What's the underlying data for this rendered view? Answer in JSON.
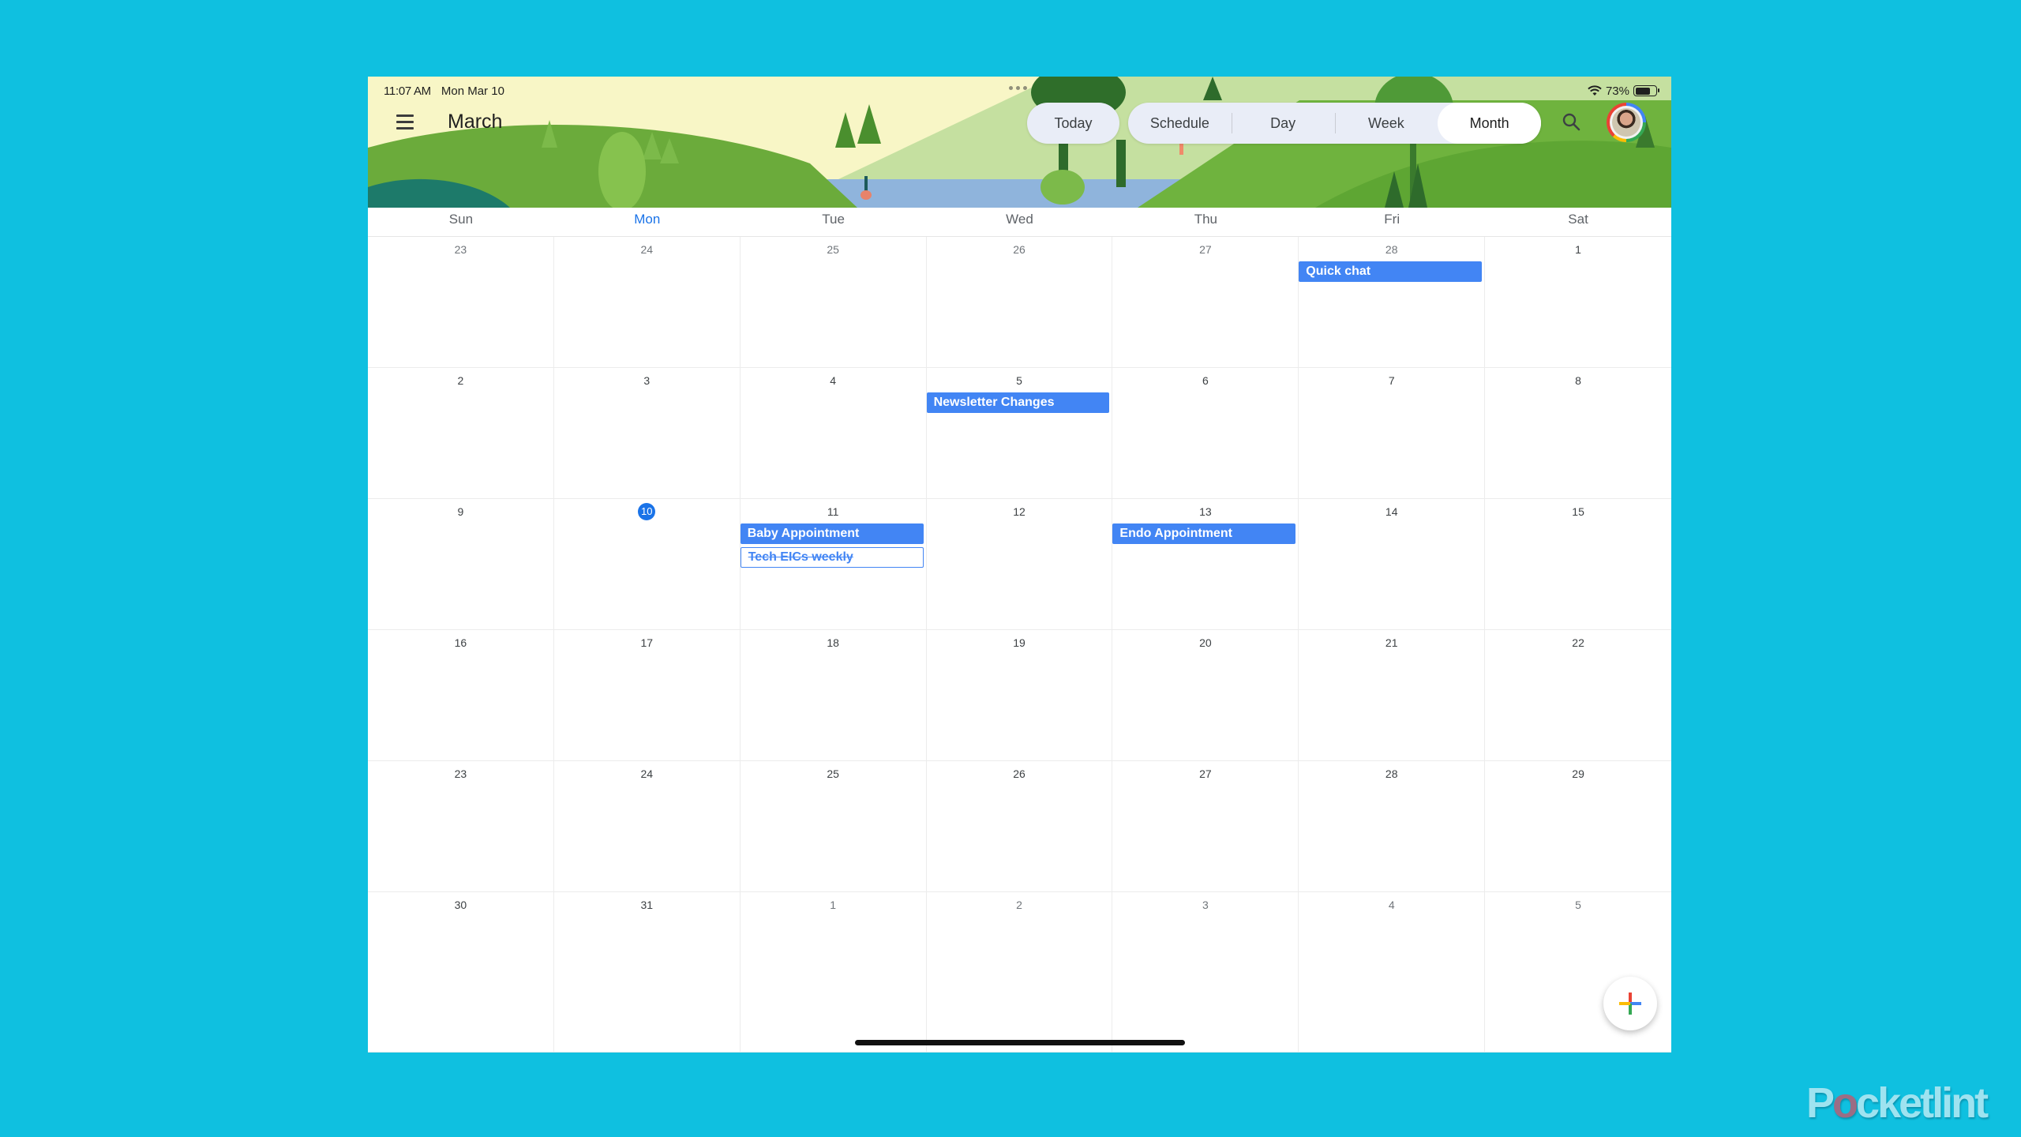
{
  "status_bar": {
    "time": "11:07 AM",
    "date": "Mon Mar 10",
    "battery": "73%",
    "battery_level": 0.73
  },
  "header": {
    "menu_icon": "hamburger-menu-icon",
    "title": "March",
    "today_label": "Today",
    "views": [
      {
        "label": "Schedule",
        "active": false
      },
      {
        "label": "Day",
        "active": false
      },
      {
        "label": "Week",
        "active": false
      },
      {
        "label": "Month",
        "active": true
      }
    ],
    "search_icon": "search-icon",
    "avatar_icon": "account-avatar"
  },
  "calendar": {
    "day_names": [
      "Sun",
      "Mon",
      "Tue",
      "Wed",
      "Thu",
      "Fri",
      "Sat"
    ],
    "today_column": 1,
    "weeks": [
      [
        {
          "d": "23",
          "other": true
        },
        {
          "d": "24",
          "other": true
        },
        {
          "d": "25",
          "other": true
        },
        {
          "d": "26",
          "other": true
        },
        {
          "d": "27",
          "other": true
        },
        {
          "d": "28",
          "other": true,
          "events": [
            {
              "title": "Quick chat"
            }
          ]
        },
        {
          "d": "1"
        }
      ],
      [
        {
          "d": "2"
        },
        {
          "d": "3"
        },
        {
          "d": "4"
        },
        {
          "d": "5",
          "events": [
            {
              "title": "Newsletter Changes"
            }
          ]
        },
        {
          "d": "6"
        },
        {
          "d": "7"
        },
        {
          "d": "8"
        }
      ],
      [
        {
          "d": "9"
        },
        {
          "d": "10",
          "today": true
        },
        {
          "d": "11",
          "events": [
            {
              "title": "Baby Appointment"
            },
            {
              "title": "Tech EICs weekly",
              "declined": true
            }
          ]
        },
        {
          "d": "12"
        },
        {
          "d": "13",
          "events": [
            {
              "title": "Endo Appointment"
            }
          ]
        },
        {
          "d": "14"
        },
        {
          "d": "15"
        }
      ],
      [
        {
          "d": "16"
        },
        {
          "d": "17"
        },
        {
          "d": "18"
        },
        {
          "d": "19"
        },
        {
          "d": "20"
        },
        {
          "d": "21"
        },
        {
          "d": "22"
        }
      ],
      [
        {
          "d": "23"
        },
        {
          "d": "24"
        },
        {
          "d": "25"
        },
        {
          "d": "26"
        },
        {
          "d": "27"
        },
        {
          "d": "28"
        },
        {
          "d": "29"
        }
      ],
      [
        {
          "d": "30"
        },
        {
          "d": "31"
        },
        {
          "d": "1",
          "other": true
        },
        {
          "d": "2",
          "other": true
        },
        {
          "d": "3",
          "other": true
        },
        {
          "d": "4",
          "other": true
        },
        {
          "d": "5",
          "other": true
        }
      ]
    ]
  },
  "fab": {
    "icon": "create-plus-icon",
    "colors": [
      "#ea4335",
      "#4285f4",
      "#34a853",
      "#fbbc04"
    ]
  },
  "colors": {
    "event_blue": "#4285f4",
    "today_blue": "#1a73e8",
    "backdrop": "#0fc0e0"
  },
  "watermark": {
    "before": "P",
    "o": "o",
    "after": "cketlint"
  }
}
